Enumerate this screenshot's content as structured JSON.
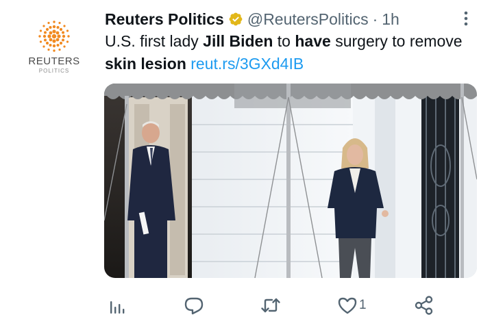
{
  "account": {
    "avatar_name": "REUTERS",
    "avatar_sub": "POLITICS",
    "display_name": "Reuters Politics",
    "handle": "@ReutersPolitics",
    "separator": "·",
    "time": "1h",
    "verified_icon": "verified-badge-icon",
    "brand_color": "#f18a21"
  },
  "tweet": {
    "t1": "U.S. first lady ",
    "t2": "Jill Biden",
    "t3": " to ",
    "t4": "have",
    "t5": " surgery to remove ",
    "t6": "skin lesion",
    "t7": " ",
    "link": "reut.rs/3GXd4IB"
  },
  "actions": {
    "analytics": {
      "icon": "analytics-icon"
    },
    "reply": {
      "icon": "reply-icon"
    },
    "retweet": {
      "icon": "retweet-icon"
    },
    "like": {
      "icon": "heart-icon",
      "count": "1"
    },
    "share": {
      "icon": "share-icon"
    }
  },
  "colors": {
    "text": "#0f1419",
    "muted": "#536471",
    "link": "#1d9bf0",
    "verified": "#e2b719"
  }
}
